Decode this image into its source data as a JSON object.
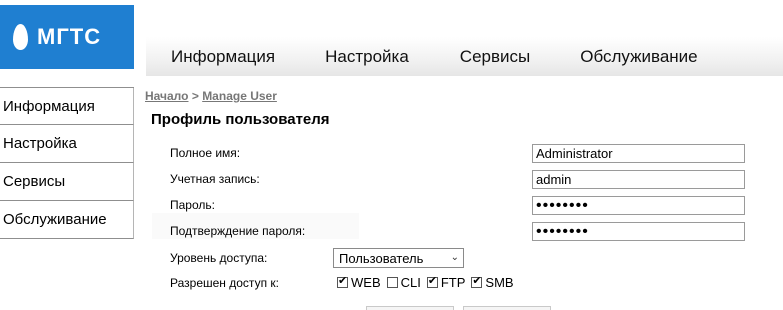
{
  "logo": {
    "text": "МГТС"
  },
  "topnav": {
    "items": [
      {
        "label": "Информация"
      },
      {
        "label": "Настройка"
      },
      {
        "label": "Сервисы"
      },
      {
        "label": "Обслуживание"
      }
    ]
  },
  "sidebar": {
    "items": [
      {
        "label": "Информация"
      },
      {
        "label": "Настройка"
      },
      {
        "label": "Сервисы"
      },
      {
        "label": "Обслуживание"
      }
    ]
  },
  "breadcrumb": {
    "home": "Начало",
    "separator": ">",
    "current": "Manage User"
  },
  "page_title": "Профиль пользователя",
  "form": {
    "full_name": {
      "label": "Полное имя:",
      "value": "Administrator"
    },
    "account": {
      "label": "Учетная запись:",
      "value": "admin"
    },
    "password": {
      "label": "Пароль:",
      "value": "••••••••"
    },
    "password_confirm": {
      "label": "Подтверждение пароля:",
      "value": "••••••••"
    },
    "access_level": {
      "label": "Уровень доступа:",
      "value": "Пользователь"
    },
    "access": {
      "label": "Разрешен доступ к:",
      "options": [
        {
          "label": "WEB",
          "checked": true
        },
        {
          "label": "CLI",
          "checked": false
        },
        {
          "label": "FTP",
          "checked": true
        },
        {
          "label": "SMB",
          "checked": true
        }
      ]
    }
  },
  "colors": {
    "brand": "#1f7fd1"
  }
}
